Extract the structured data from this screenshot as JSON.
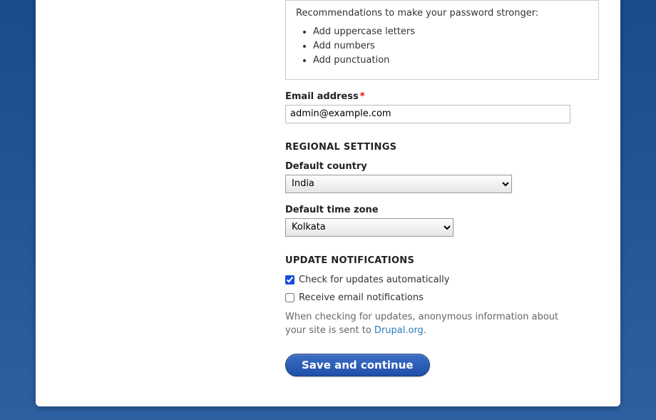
{
  "password_box": {
    "intro": "Recommendations to make your password stronger:",
    "tips": [
      "Add uppercase letters",
      "Add numbers",
      "Add punctuation"
    ]
  },
  "email": {
    "label": "Email address",
    "value": "admin@example.com"
  },
  "regional": {
    "heading": "REGIONAL SETTINGS",
    "country_label": "Default country",
    "country_value": "India",
    "tz_label": "Default time zone",
    "tz_value": "Kolkata"
  },
  "updates": {
    "heading": "UPDATE NOTIFICATIONS",
    "check_label": "Check for updates automatically",
    "check_checked": true,
    "email_label": "Receive email notifications",
    "email_checked": false,
    "help_pre": "When checking for updates, anonymous information about your site is sent to ",
    "help_link": "Drupal.org",
    "help_post": "."
  },
  "submit_label": "Save and continue"
}
